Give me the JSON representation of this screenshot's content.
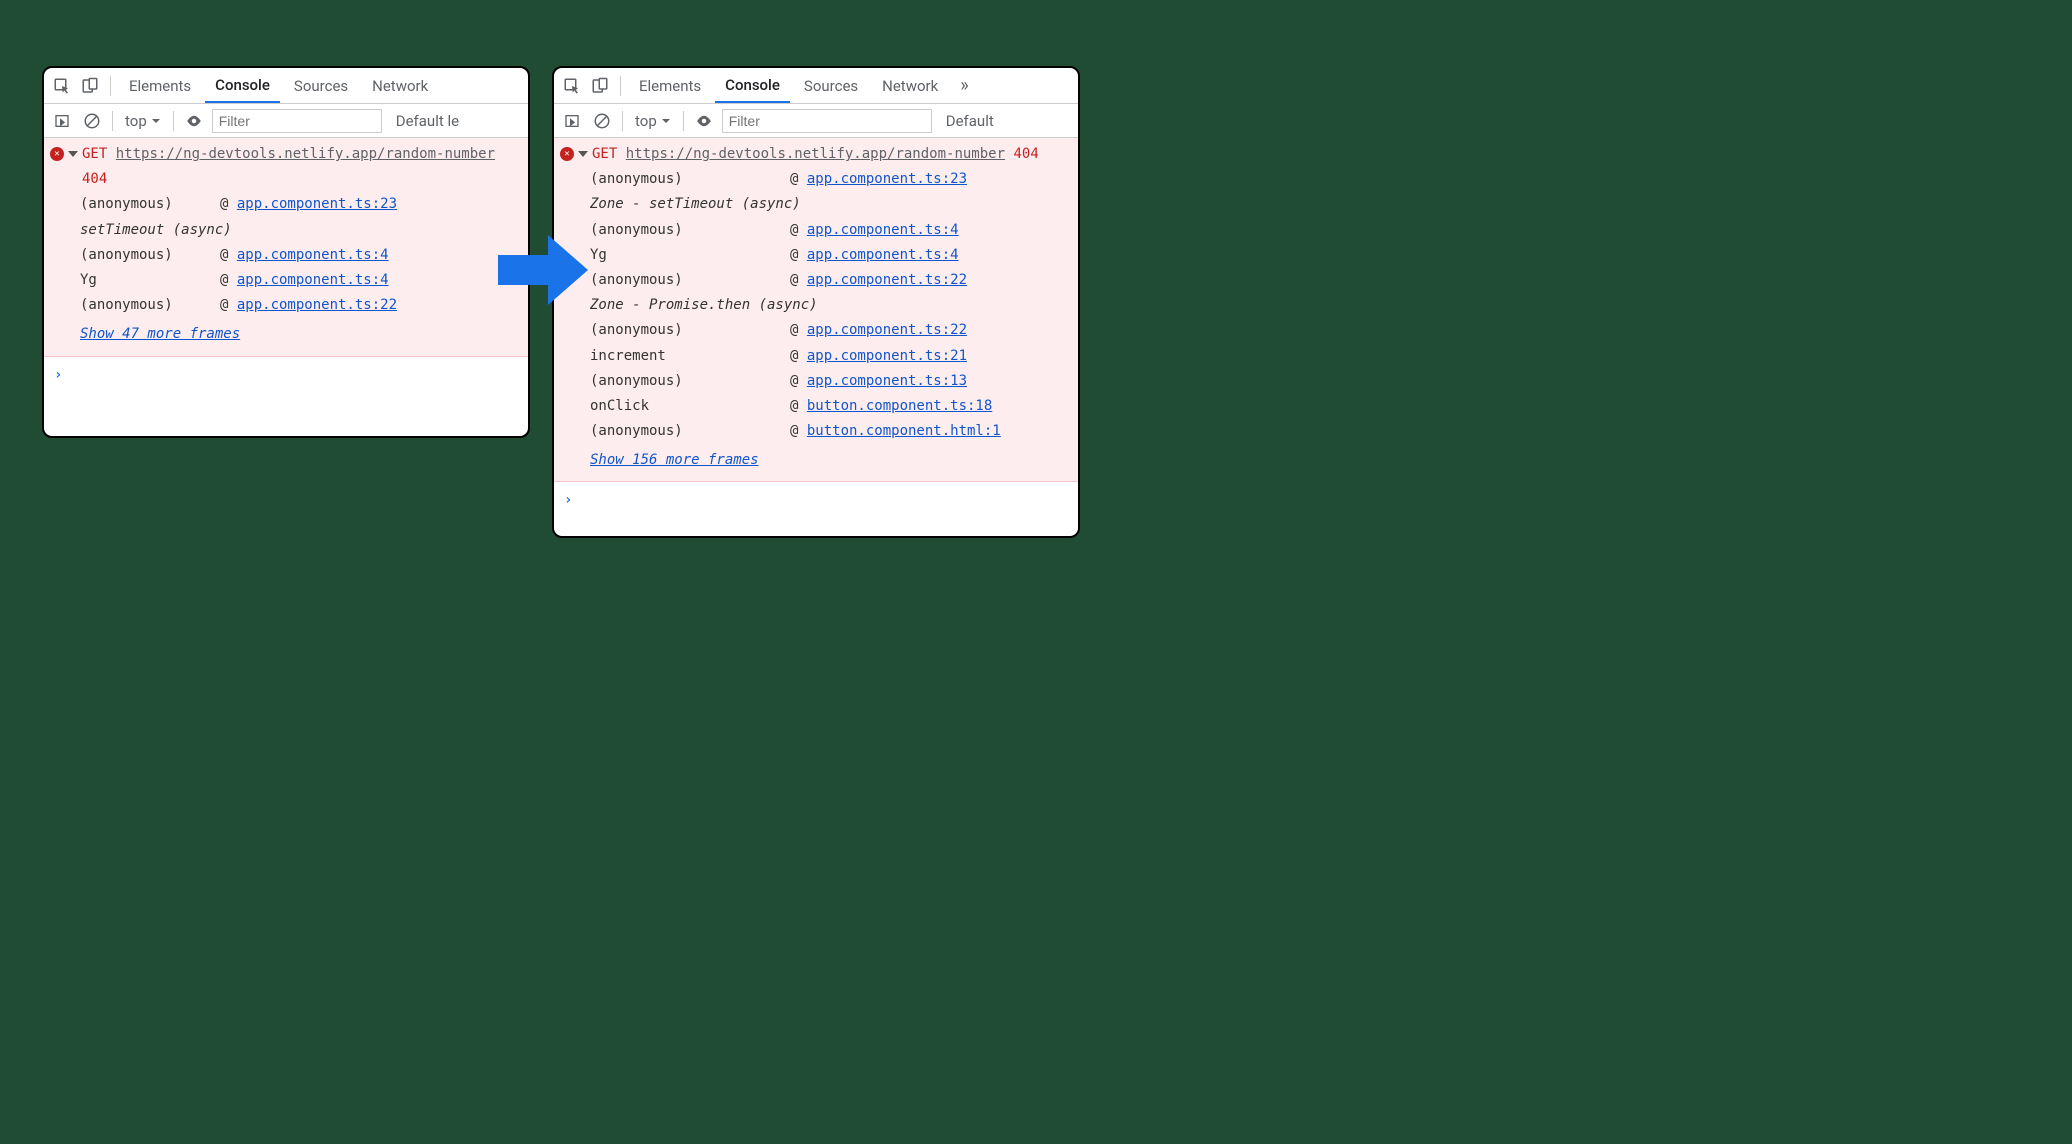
{
  "tabs": {
    "elements": "Elements",
    "console": "Console",
    "sources": "Sources",
    "network": "Network",
    "more": "»"
  },
  "toolbar": {
    "context": "top",
    "filterPlaceholder": "Filter",
    "levelsLeft": "Default le",
    "levelsRight": "Default"
  },
  "left": {
    "method": "GET",
    "url": "https://ng-devtools.netlify.app/random-number",
    "status": "404",
    "trace": [
      {
        "fn": "(anonymous)",
        "at": "@",
        "link": "app.component.ts:23"
      },
      {
        "async": "setTimeout (async)"
      },
      {
        "fn": "(anonymous)",
        "at": "@",
        "link": "app.component.ts:4"
      },
      {
        "fn": "Yg",
        "at": "@",
        "link": "app.component.ts:4"
      },
      {
        "fn": "(anonymous)",
        "at": "@",
        "link": "app.component.ts:22"
      }
    ],
    "showMore": "Show 47 more frames"
  },
  "right": {
    "method": "GET",
    "url": "https://ng-devtools.netlify.app/random-number",
    "status": "404",
    "trace": [
      {
        "fn": "(anonymous)",
        "at": "@",
        "link": "app.component.ts:23"
      },
      {
        "async": "Zone - setTimeout (async)"
      },
      {
        "fn": "(anonymous)",
        "at": "@",
        "link": "app.component.ts:4"
      },
      {
        "fn": "Yg",
        "at": "@",
        "link": "app.component.ts:4"
      },
      {
        "fn": "(anonymous)",
        "at": "@",
        "link": "app.component.ts:22"
      },
      {
        "async": "Zone - Promise.then (async)"
      },
      {
        "fn": "(anonymous)",
        "at": "@",
        "link": "app.component.ts:22"
      },
      {
        "fn": "increment",
        "at": "@",
        "link": "app.component.ts:21"
      },
      {
        "fn": "(anonymous)",
        "at": "@",
        "link": "app.component.ts:13"
      },
      {
        "fn": "onClick",
        "at": "@",
        "link": "button.component.ts:18"
      },
      {
        "fn": "(anonymous)",
        "at": "@",
        "link": "button.component.html:1"
      }
    ],
    "showMore": "Show 156 more frames"
  }
}
